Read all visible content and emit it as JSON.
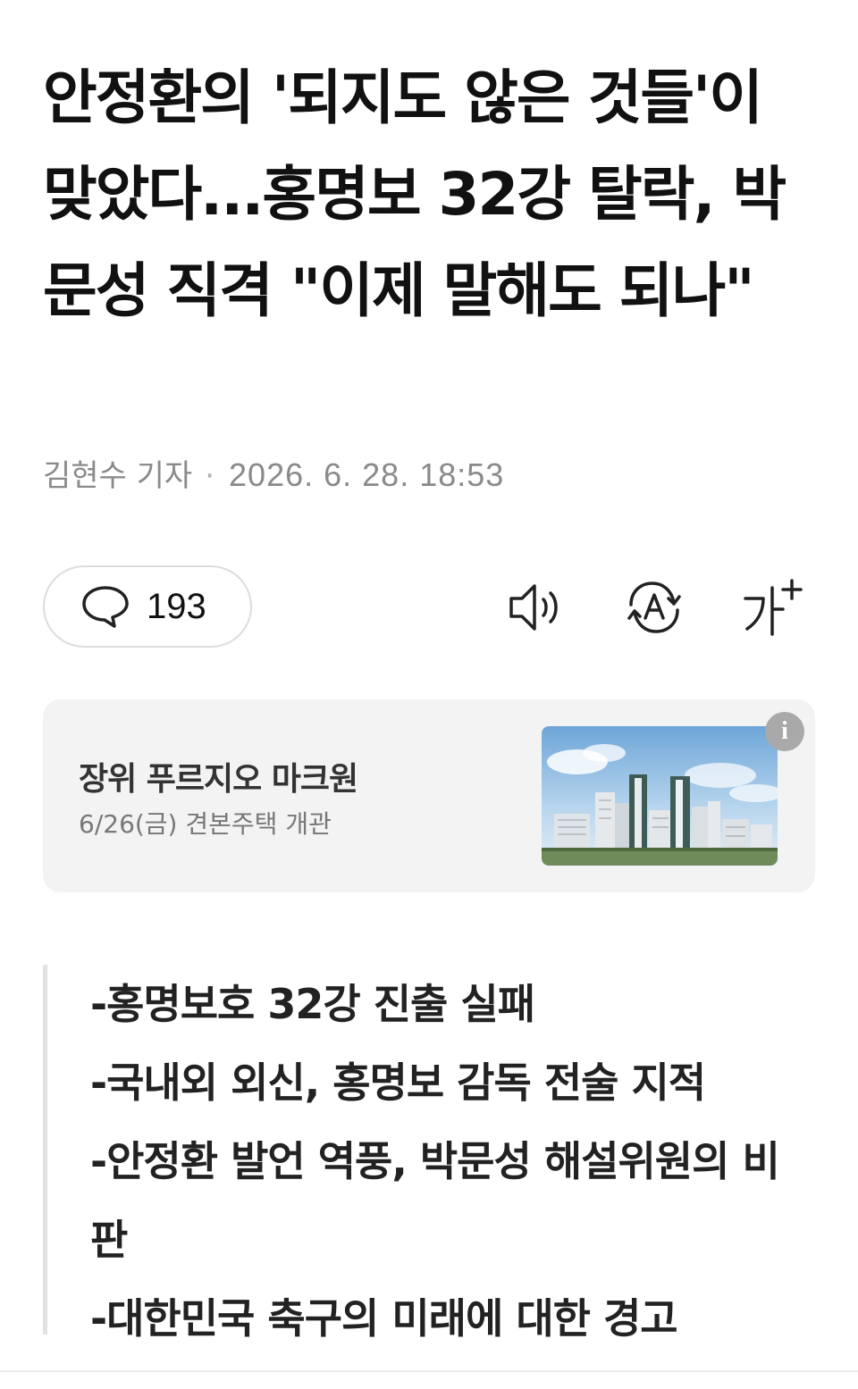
{
  "article": {
    "headline": "안정환의 '되지도 않은 것들'이 맞았다...홍명보 32강 탈락, 박문성 직격 \"이제 말해도 되나\"",
    "reporter": "김현수 기자",
    "separator": "·",
    "datetime": "2026. 6. 28. 18:53"
  },
  "toolbar": {
    "comment_count": "193",
    "icons": [
      "comment-icon",
      "speaker-icon",
      "translate-icon",
      "font-size-icon"
    ]
  },
  "ad": {
    "title": "장위 푸르지오 마크원",
    "subtitle": "6/26(금) 견본주택 개관",
    "info_label": "i"
  },
  "summary": {
    "items": [
      "-홍명보호 32강 진출 실패",
      "-국내외 외신, 홍명보 감독 전술 지적",
      "-안정환 발언 역풍, 박문성 해설위원의 비판",
      "-대한민국 축구의 미래에 대한 경고"
    ]
  },
  "colors": {
    "text": "#111111",
    "muted": "#8a8a8a",
    "ad_background": "#f3f3f3",
    "quote_bar": "#e2e2e2"
  }
}
